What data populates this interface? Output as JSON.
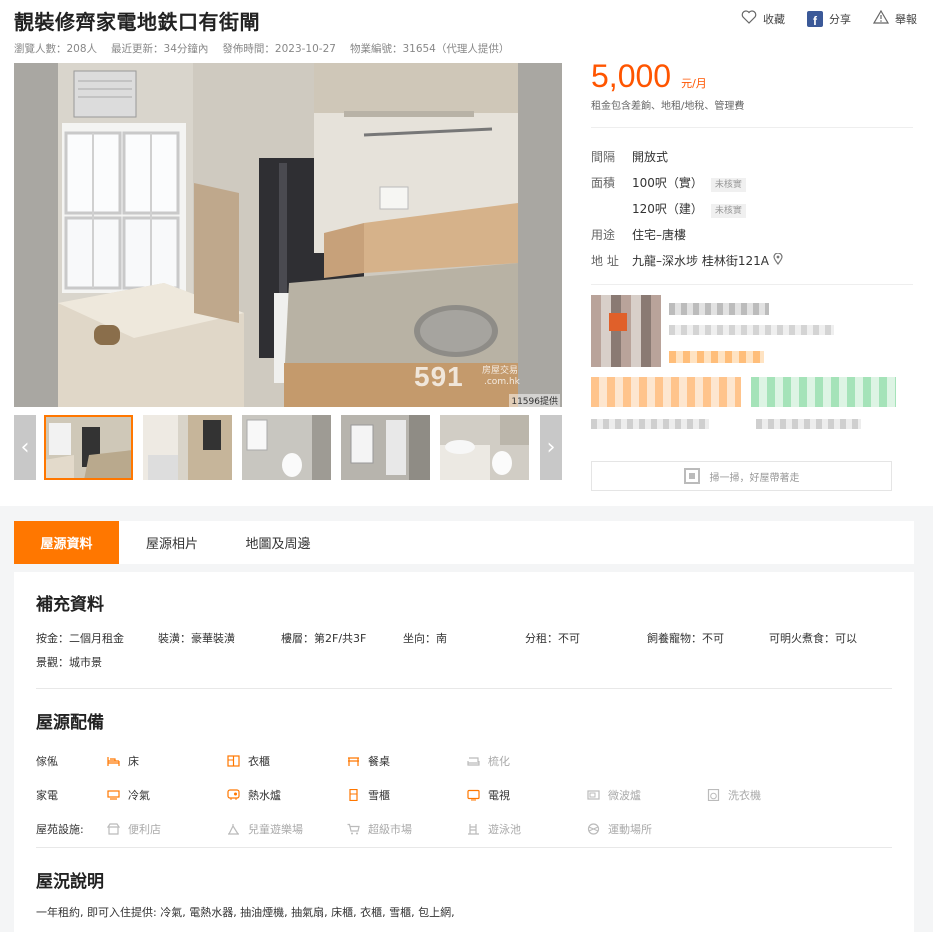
{
  "header": {
    "title": "靚裝修齊家電地鉄口有街閘",
    "actions": {
      "save": "收藏",
      "share": "分享",
      "report": "舉報"
    },
    "meta": {
      "views": "瀏覽人數：208人",
      "updated": "最近更新：34分鐘內",
      "published": "發佈時間：2023-10-27",
      "listing_id": "物業編號：31654（代理人提供）"
    }
  },
  "gallery": {
    "watermark": "591",
    "watermark_sub": "房屋交易",
    "watermark_domain": ".com.hk",
    "credit": "11596提供",
    "prev": "‹",
    "next": "›"
  },
  "pricing": {
    "price": "5,000",
    "unit": "元/月",
    "note": "租金包含差餉、地租/地稅、管理費"
  },
  "details": {
    "layout_label": "間隔",
    "layout_value": "開放式",
    "area_label": "面積",
    "area_actual": "100呎（實）",
    "area_built": "120呎（建）",
    "unverified": "未核實",
    "usage_label": "用途",
    "usage_value": "住宅–唐樓",
    "address_label": "地 址",
    "address_value": "九龍–深水埗 桂林街121A"
  },
  "qr_text": "掃一掃，好屋帶著走",
  "tabs": {
    "info": "屋源資料",
    "photos": "屋源相片",
    "map": "地圖及周邊"
  },
  "supplement": {
    "title": "補充資料",
    "deposit": "按金：二個月租金",
    "decoration": "裝潢：豪華裝潢",
    "floor": "樓層：第2F/共3F",
    "facing": "坐向：南",
    "sublet": "分租：不可",
    "pets": "飼養寵物：不可",
    "cooking": "可明火煮食：可以",
    "view": "景觀：城市景"
  },
  "equipment": {
    "title": "屋源配備",
    "furniture_label": "傢俬",
    "appliance_label": "家電",
    "estate_label": "屋苑設施:",
    "furniture": [
      "床",
      "衣櫃",
      "餐桌",
      "梳化"
    ],
    "appliances": [
      "冷氣",
      "熱水爐",
      "雪櫃",
      "電視",
      "微波爐",
      "洗衣機"
    ],
    "estate": [
      "便利店",
      "兒童遊樂場",
      "超級市場",
      "遊泳池",
      "運動場所"
    ]
  },
  "condition": {
    "title": "屋況說明",
    "text": "一年租約, 即可入住提供: 冷氣, 電熱水器, 抽油煙機, 抽氣扇, 床櫃, 衣櫃, 雪櫃, 包上網,"
  },
  "colors": {
    "accent": "#ff7700",
    "price": "#ff5500",
    "facebook": "#3b5998"
  }
}
